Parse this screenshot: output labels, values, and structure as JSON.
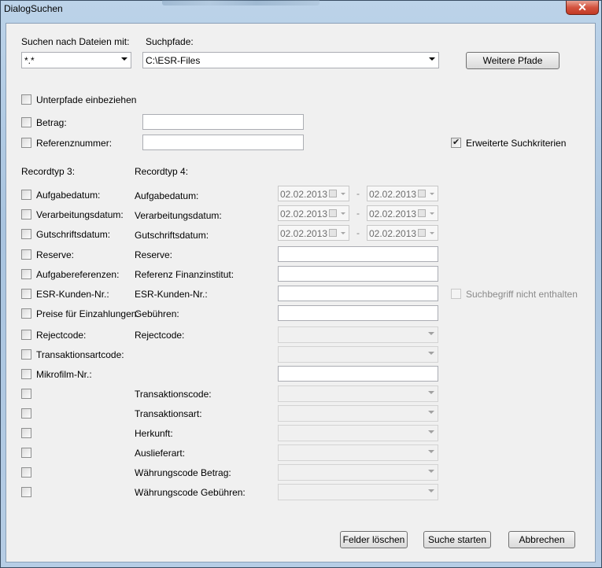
{
  "window": {
    "title": "DialogSuchen",
    "close_glyph": "✕"
  },
  "search": {
    "files_label": "Suchen nach Dateien mit:",
    "files_value": "*.*",
    "paths_label": "Suchpfade:",
    "paths_value": "C:\\ESR-Files",
    "more_paths_button": "Weitere Pfade"
  },
  "options": {
    "subpaths": "Unterpfade einbeziehen",
    "betrag": "Betrag:",
    "referenznummer": "Referenznummer:",
    "extended_criteria": "Erweiterte Suchkriterien",
    "extended_criteria_checked": true
  },
  "headers": {
    "rt3": "Recordtyp 3:",
    "rt4": "Recordtyp 4:"
  },
  "rows": {
    "aufgabedatum": {
      "rt3": "Aufgabedatum:",
      "rt4": "Aufgabedatum:",
      "from": "02.02.2013",
      "to": "02.02.2013"
    },
    "verarbeitungsdatum": {
      "rt3": "Verarbeitungsdatum:",
      "rt4": "Verarbeitungsdatum:",
      "from": "02.02.2013",
      "to": "02.02.2013"
    },
    "gutschriftsdatum": {
      "rt3": "Gutschriftsdatum:",
      "rt4": "Gutschriftsdatum:",
      "from": "02.02.2013",
      "to": "02.02.2013"
    },
    "reserve": {
      "rt3": "Reserve:",
      "rt4": "Reserve:"
    },
    "aufgabereferenzen": {
      "rt3": "Aufgabereferenzen:",
      "rt4": "Referenz Finanzinstitut:"
    },
    "esr_kunden_nr": {
      "rt3": "ESR-Kunden-Nr.:",
      "rt4": "ESR-Kunden-Nr.:",
      "not_contained": "Suchbegriff nicht enthalten"
    },
    "preise": {
      "rt3": "Preise für Einzahlungen:",
      "rt4": "Gebühren:"
    },
    "rejectcode": {
      "rt3": "Rejectcode:",
      "rt4": "Rejectcode:"
    },
    "transaktionsartcode": {
      "rt3": "Transaktionsartcode:"
    },
    "mikrofilm": {
      "rt3": "Mikrofilm-Nr.:"
    },
    "transaktionscode": {
      "rt4": "Transaktionscode:"
    },
    "transaktionsart": {
      "rt4": "Transaktionsart:"
    },
    "herkunft": {
      "rt4": "Herkunft:"
    },
    "auslieferart": {
      "rt4": "Auslieferart:"
    },
    "waehrung_betrag": {
      "rt4": "Währungscode Betrag:"
    },
    "waehrung_gebuehren": {
      "rt4": "Währungscode Gebühren:"
    },
    "range_separator": "-"
  },
  "buttons": {
    "clear": "Felder löschen",
    "start": "Suche starten",
    "cancel": "Abbrechen"
  }
}
